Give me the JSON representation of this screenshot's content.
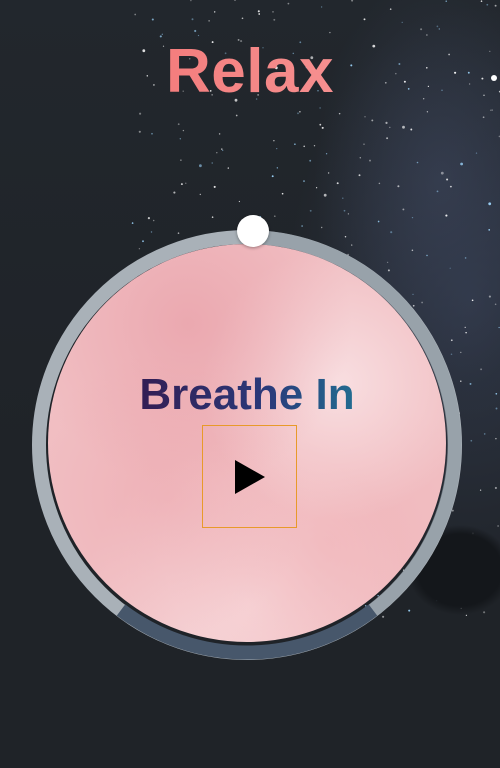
{
  "app": {
    "title": "Relax",
    "phase_label": "Breathe In"
  },
  "controls": {
    "play_icon": "play-icon",
    "progress": 0.0
  },
  "colors": {
    "title_gradient": [
      "#f26b6b",
      "#f8a2a2"
    ],
    "phase_gradient": [
      "#3a0838",
      "#2a3a7a",
      "#1aa0a8"
    ],
    "ring_track": "#a9b1b8",
    "ring_dark": "#47576b",
    "play_border": "#e89a2a",
    "background": "#1f2328"
  }
}
